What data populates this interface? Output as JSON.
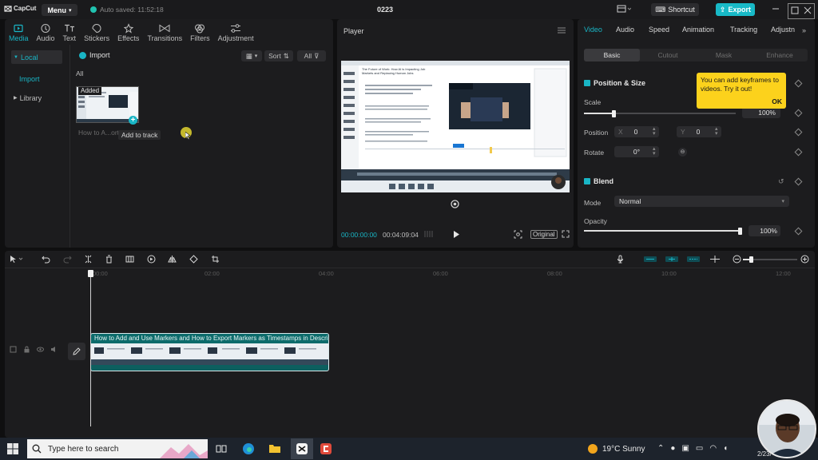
{
  "app": {
    "logo": "CapCut",
    "menu_label": "Menu",
    "autosave": "Auto saved: 11:52:18",
    "project_title": "0223",
    "shortcut_label": "Shortcut",
    "export_label": "Export"
  },
  "media_panel": {
    "tabs": [
      {
        "label": "Media",
        "icon": "media-icon",
        "active": true
      },
      {
        "label": "Audio",
        "icon": "audio-icon"
      },
      {
        "label": "Text",
        "icon": "text-icon"
      },
      {
        "label": "Stickers",
        "icon": "stickers-icon"
      },
      {
        "label": "Effects",
        "icon": "effects-icon"
      },
      {
        "label": "Transitions",
        "icon": "transitions-icon"
      },
      {
        "label": "Filters",
        "icon": "filters-icon"
      },
      {
        "label": "Adjustment",
        "icon": "adjustment-icon"
      }
    ],
    "nav": {
      "local": "Local",
      "import": "Import",
      "library": "Library"
    },
    "import_label": "Import",
    "sort_label": "Sort",
    "filter_all": "All",
    "section_all": "All",
    "media_item": {
      "badge": "Added",
      "name": "How to A...ort",
      "tooltip": "Add to track"
    }
  },
  "player": {
    "title": "Player",
    "current_time": "00:00:00:00",
    "total_time": "00:04:09:04",
    "original_label": "Original",
    "preview_heading": "The Future of Work: How AI is Impacting Job Markets and Replacing Human Jobs"
  },
  "properties": {
    "tabs": [
      "Video",
      "Audio",
      "Speed",
      "Animation",
      "Tracking",
      "Adjustn"
    ],
    "subtabs": [
      "Basic",
      "Cutout",
      "Mask",
      "Enhance"
    ],
    "position_size": {
      "title": "Position & Size",
      "scale_label": "Scale",
      "scale_value": "100%",
      "scale_level": 0.2,
      "position_label": "Position",
      "x_label": "X",
      "x_value": "0",
      "y_label": "Y",
      "y_value": "0",
      "rotate_label": "Rotate",
      "rotate_value": "0°"
    },
    "blend": {
      "title": "Blend",
      "mode_label": "Mode",
      "mode_value": "Normal",
      "opacity_label": "Opacity",
      "opacity_value": "100%",
      "opacity_level": 1.0
    },
    "keyframe_tip": {
      "text": "You can add keyframes to videos. Try it out!",
      "ok": "OK"
    }
  },
  "timeline": {
    "ruler_labels": [
      "00:00",
      "02:00",
      "04:00",
      "06:00",
      "08:00",
      "10:00",
      "12:00"
    ],
    "clip_title": "How to Add and Use Markers and How to Export Markers as Timestamps in Descrip"
  },
  "taskbar": {
    "search_placeholder": "Type here to search",
    "weather": "19°C  Sunny",
    "date_partial": "2/23/"
  },
  "colors": {
    "accent": "#19b5c5",
    "tooltip_yellow": "#fcd21c",
    "panel": "#1c1c1e"
  }
}
